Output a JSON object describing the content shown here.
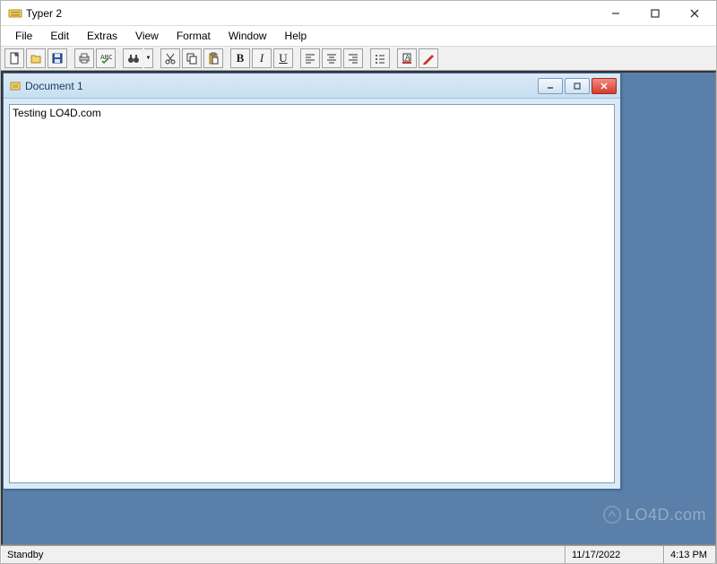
{
  "app": {
    "title": "Typer 2"
  },
  "menubar": {
    "items": [
      {
        "label": "File"
      },
      {
        "label": "Edit"
      },
      {
        "label": "Extras"
      },
      {
        "label": "View"
      },
      {
        "label": "Format"
      },
      {
        "label": "Window"
      },
      {
        "label": "Help"
      }
    ]
  },
  "toolbar": {
    "icons": {
      "new": "new-file-icon",
      "open": "open-folder-icon",
      "save": "save-disk-icon",
      "print": "print-icon",
      "spell": "spellcheck-icon",
      "find": "binoculars-icon",
      "cut": "cut-icon",
      "copy": "copy-icon",
      "paste": "paste-icon",
      "bold": "bold-icon",
      "italic": "italic-icon",
      "underline": "underline-icon",
      "align_left": "align-left-icon",
      "align_center": "align-center-icon",
      "align_right": "align-right-icon",
      "bullets": "bullets-icon",
      "highlight": "highlight-color-icon",
      "pen": "pen-icon"
    },
    "bold_label": "B",
    "italic_label": "I",
    "underline_label": "U"
  },
  "doc": {
    "title": "Document 1",
    "content": "Testing LO4D.com"
  },
  "status": {
    "text": "Standby",
    "date": "11/17/2022",
    "time": "4:13 PM"
  },
  "watermark": "LO4D.com"
}
